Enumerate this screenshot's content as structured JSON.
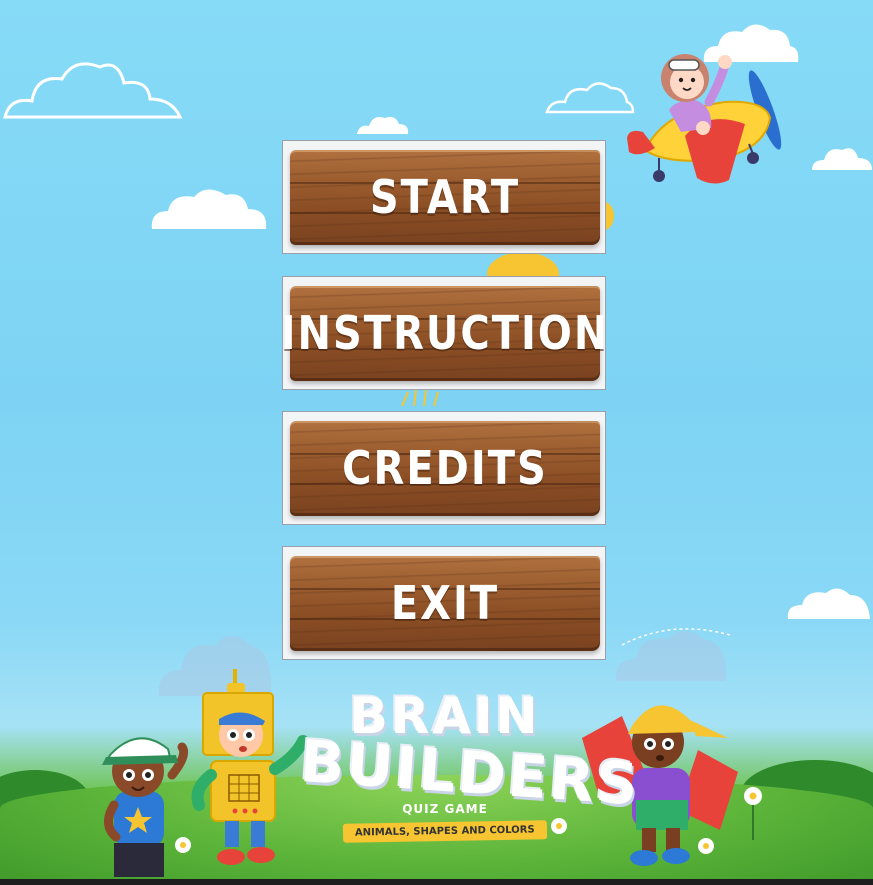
{
  "menu": {
    "start_label": "START",
    "instruction_label": "INSTRUCTION",
    "credits_label": "CREDITS",
    "exit_label": "EXIT"
  },
  "logo": {
    "line1": "BRAIN",
    "line2": "BUILDERS",
    "subtitle": "QUIZ GAME",
    "banner": "ANIMALS, SHAPES AND COLORS"
  },
  "colors": {
    "sky": "#7ed3f4",
    "wood": "#9a5c2e",
    "grass": "#5db53a",
    "banner": "#f6c531"
  },
  "icons": [
    "cloud-icon",
    "airplane-icon",
    "pilot-character",
    "robot-kid-character",
    "cap-kid-character",
    "flower-icon",
    "sun-icon"
  ]
}
